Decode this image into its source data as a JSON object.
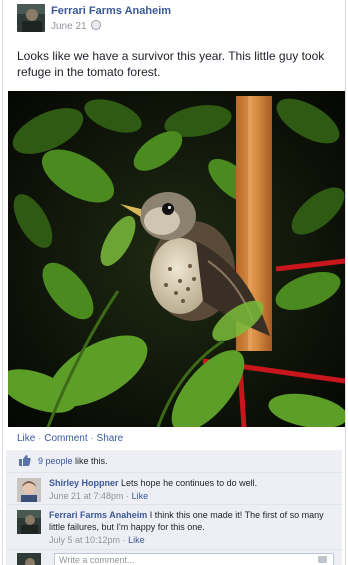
{
  "post": {
    "page_name": "Ferrari Farms Anaheim",
    "date": "June 21",
    "privacy_icon": "globe-icon",
    "message": "Looks like we have a survivor this year. This little guy took refuge in the tomato forest."
  },
  "actions": {
    "like": "Like",
    "comment": "Comment",
    "share": "Share",
    "separator": "·"
  },
  "likes": {
    "count_link": "9 people",
    "suffix": " like this."
  },
  "comments": [
    {
      "author": "Shirley Hoppner",
      "text": "Lets hope he continues to do well.",
      "time": "June 21 at 7:48pm",
      "like": "Like"
    },
    {
      "author": "Ferrari Farms Anaheim",
      "text": "I think this one made it! The first of so many little failures, but I'm happy for this one.",
      "time": "July 5 at 10:12pm",
      "like": "Like"
    }
  ],
  "composer": {
    "placeholder": "Write a comment..."
  },
  "colors": {
    "link": "#3b5998",
    "ufi_background": "#edeff4"
  }
}
